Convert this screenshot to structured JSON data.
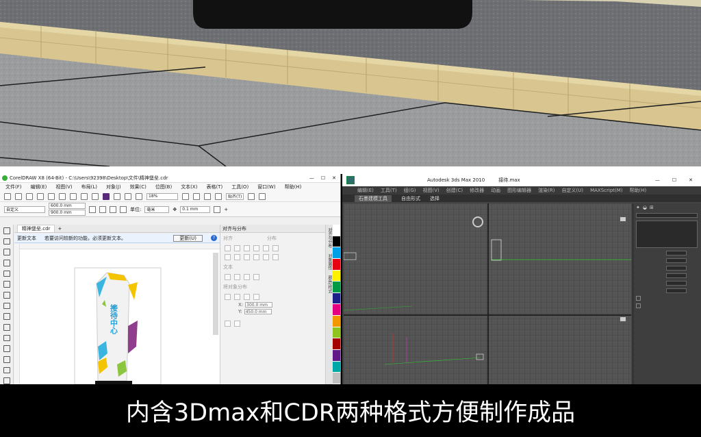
{
  "cdr": {
    "title": "CorelDRAW X8 (64-Bit) - C:\\Users\\92398\\Desktop\\文件\\精神堡垒.cdr",
    "menu": [
      "文件(F)",
      "编辑(E)",
      "视图(V)",
      "布局(L)",
      "对象(J)",
      "效果(C)",
      "位图(B)",
      "文本(X)",
      "表格(T)",
      "工具(O)",
      "窗口(W)",
      "帮助(H)"
    ],
    "zoom": "18%",
    "paste_label": "贴齐(T)",
    "preset": "自定义",
    "width": "600.0 mm",
    "height": "900.0 mm",
    "units_label": "单位:",
    "units": "毫米",
    "nudge": "0.1 mm",
    "doc_tab": "精神堡垒.cdr",
    "notice_title": "更新文本",
    "notice_text": "若要访问较新的功能，必须更新文本。",
    "update_button": "更新(U)",
    "docker_title": "对齐与分布",
    "docker_align": "对齐",
    "docker_distribute": "分布",
    "docker_text": "文本",
    "docker_object_distance": "将对象分布",
    "x_label": "X:",
    "x_value": "300.0 mm",
    "y_label": "Y:",
    "y_value": "450.0 mm",
    "vtabs": [
      "对齐与分布",
      "对象属性",
      "颜色/样式"
    ],
    "palette": [
      "#ffffff",
      "#000000",
      "#00a0e9",
      "#e60012",
      "#fff100",
      "#009944",
      "#1d2088",
      "#e4007f",
      "#f39800",
      "#8fc31f",
      "#a40000",
      "#601986",
      "#00a7a7",
      "#c0c0c0"
    ],
    "sign_vertical_text": "接待中心"
  },
  "max": {
    "title": "Autodesk 3ds Max 2010",
    "file": "接待.max",
    "menu": [
      "编辑(E)",
      "工具(T)",
      "组(G)",
      "视图(V)",
      "创建(C)",
      "修改器",
      "动画",
      "图形编辑器",
      "渲染(R)",
      "自定义(U)",
      "MAXScript(M)",
      "帮助(H)"
    ],
    "ribbon": [
      "石墨建模工具",
      "自由形式",
      "选择"
    ]
  },
  "caption": "内含3Dmax和CDR两种格式方便制作成品"
}
